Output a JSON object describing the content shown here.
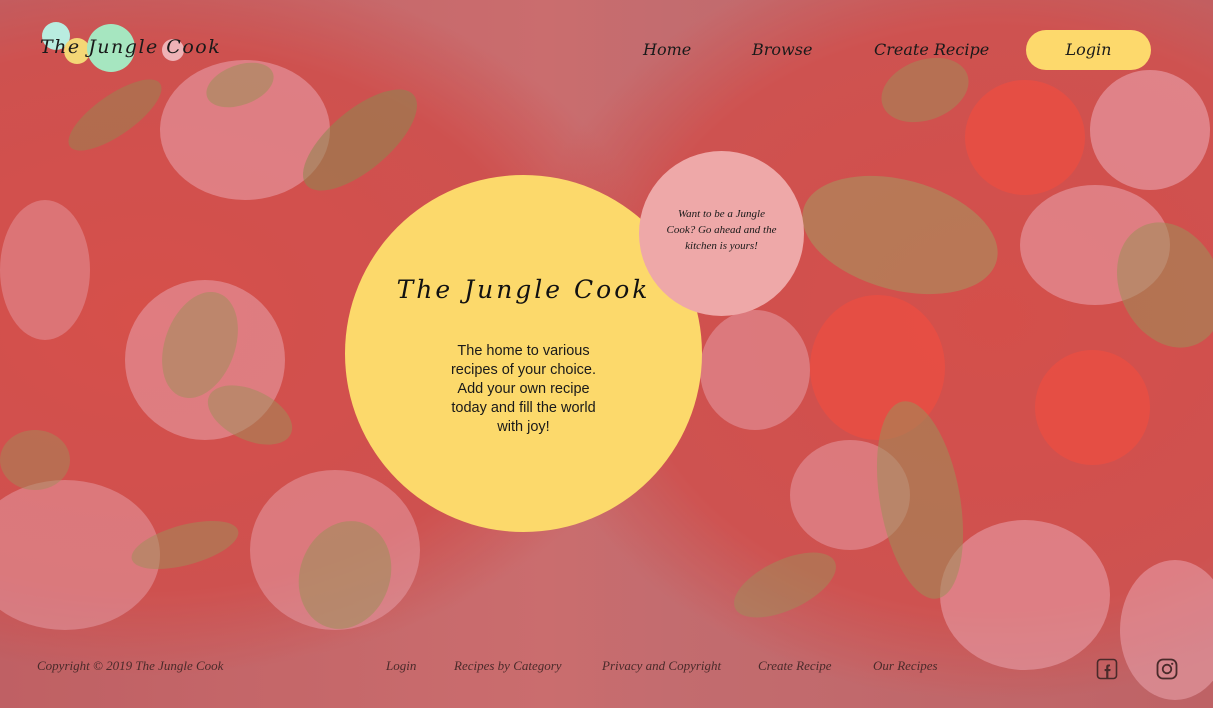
{
  "brand": {
    "logo_text": "The Jungle Cook"
  },
  "nav": {
    "items": [
      {
        "label": "Home"
      },
      {
        "label": "Browse"
      },
      {
        "label": "Create Recipe"
      }
    ],
    "login_label": "Login"
  },
  "hero": {
    "title": "The Jungle Cook",
    "text": "The home to various recipes of your choice. Add your own recipe today and fill the world with joy!"
  },
  "promo": {
    "text": "Want to be a Jungle Cook? Go ahead and the kitchen is yours!"
  },
  "footer": {
    "copyright": "Copyright © 2019 The Jungle Cook",
    "links": [
      {
        "label": "Login"
      },
      {
        "label": "Recipes by Category"
      },
      {
        "label": "Privacy and Copyright"
      },
      {
        "label": "Create Recipe"
      },
      {
        "label": "Our Recipes"
      }
    ],
    "social": [
      {
        "icon": "facebook-icon"
      },
      {
        "icon": "instagram-icon"
      }
    ]
  },
  "colors": {
    "accent_yellow": "#fcd96b",
    "accent_pink": "#eea8a8",
    "logo_green": "#a6e6c0",
    "logo_teal": "#b9ece0",
    "background_overlay": "#c8545a"
  }
}
